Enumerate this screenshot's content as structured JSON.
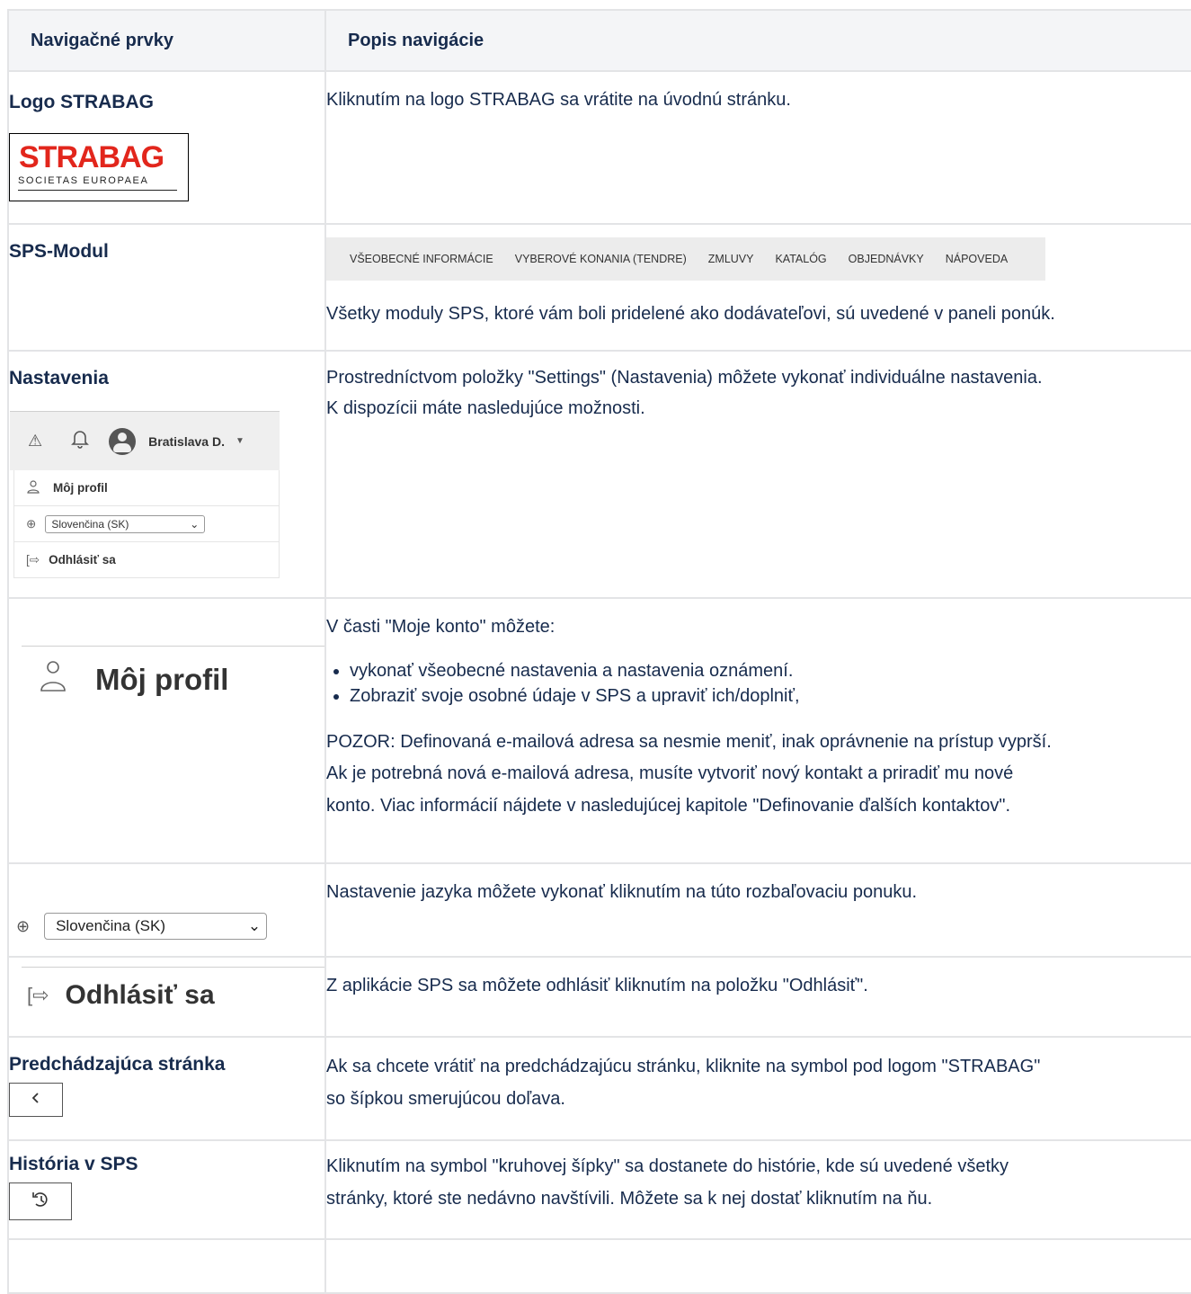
{
  "table": {
    "header": [
      "Navigačné prvky",
      "Popis navigácie"
    ],
    "rows": {
      "logo": {
        "label": "Logo STRABAG",
        "logo_text": "STRABAG",
        "logo_sub": "SOCIETAS EUROPAEA",
        "desc": "Kliknutím na logo STRABAG sa vrátite na úvodnú stránku."
      },
      "sps": {
        "label": "SPS-Modul",
        "menu": [
          "VŠEOBECNÉ INFORMÁCIE",
          "VYBEROVÉ KONANIA (TENDRE)",
          "ZMLUVY",
          "KATALÓG",
          "OBJEDNÁVKY",
          "NÁPOVEDA"
        ],
        "desc": "Všetky moduly SPS, ktoré vám boli pridelené ako dodávateľovi, sú uvedené v paneli ponúk."
      },
      "settings": {
        "label": "Nastavenia",
        "user": "Bratislava D.",
        "profile": "Môj profil",
        "language": "Slovenčina (SK)",
        "logout": "Odhlásiť sa",
        "desc1": "Prostredníctvom položky \"Settings\" (Nastavenia) môžete vykonať individuálne nastavenia.",
        "desc2": "K dispozícii máte nasledujúce možnosti."
      },
      "profile": {
        "label": "Môj profil",
        "intro": "V časti \"Moje konto\" môžete:",
        "bullets": [
          "vykonať všeobecné nastavenia a nastavenia oznámení.",
          "Zobraziť svoje osobné údaje v SPS a upraviť ich/doplniť,"
        ],
        "warn1": "POZOR: Definovaná e-mailová adresa sa nesmie meniť, inak oprávnenie na prístup vyprší.",
        "warn2": "Ak je potrebná nová e-mailová adresa, musíte vytvoriť nový kontakt a priradiť mu nové",
        "warn3": "konto. Viac informácií nájdete v nasledujúcej kapitole \"Definovanie ďalších kontaktov\"."
      },
      "language": {
        "value": "Slovenčina (SK)",
        "desc": "Nastavenie jazyka môžete vykonať kliknutím na túto rozbaľovaciu ponuku."
      },
      "logout": {
        "label": "Odhlásiť sa",
        "desc": "Z aplikácie SPS sa môžete odhlásiť kliknutím na položku \"Odhlásiť\"."
      },
      "previous": {
        "label": "Predchádzajúca stránka",
        "desc1": "Ak sa chcete vrátiť na predchádzajúcu stránku, kliknite na symbol pod logom \"STRABAG\"",
        "desc2": "so šípkou smerujúcou doľava."
      },
      "history": {
        "label": "História v SPS",
        "desc1": "Kliknutím na symbol \"kruhovej šípky\" sa dostanete do histórie, kde sú uvedené všetky",
        "desc2": "stránky, ktoré ste nedávno navštívili. Môžete sa k nej dostať kliknutím na ňu."
      }
    }
  }
}
